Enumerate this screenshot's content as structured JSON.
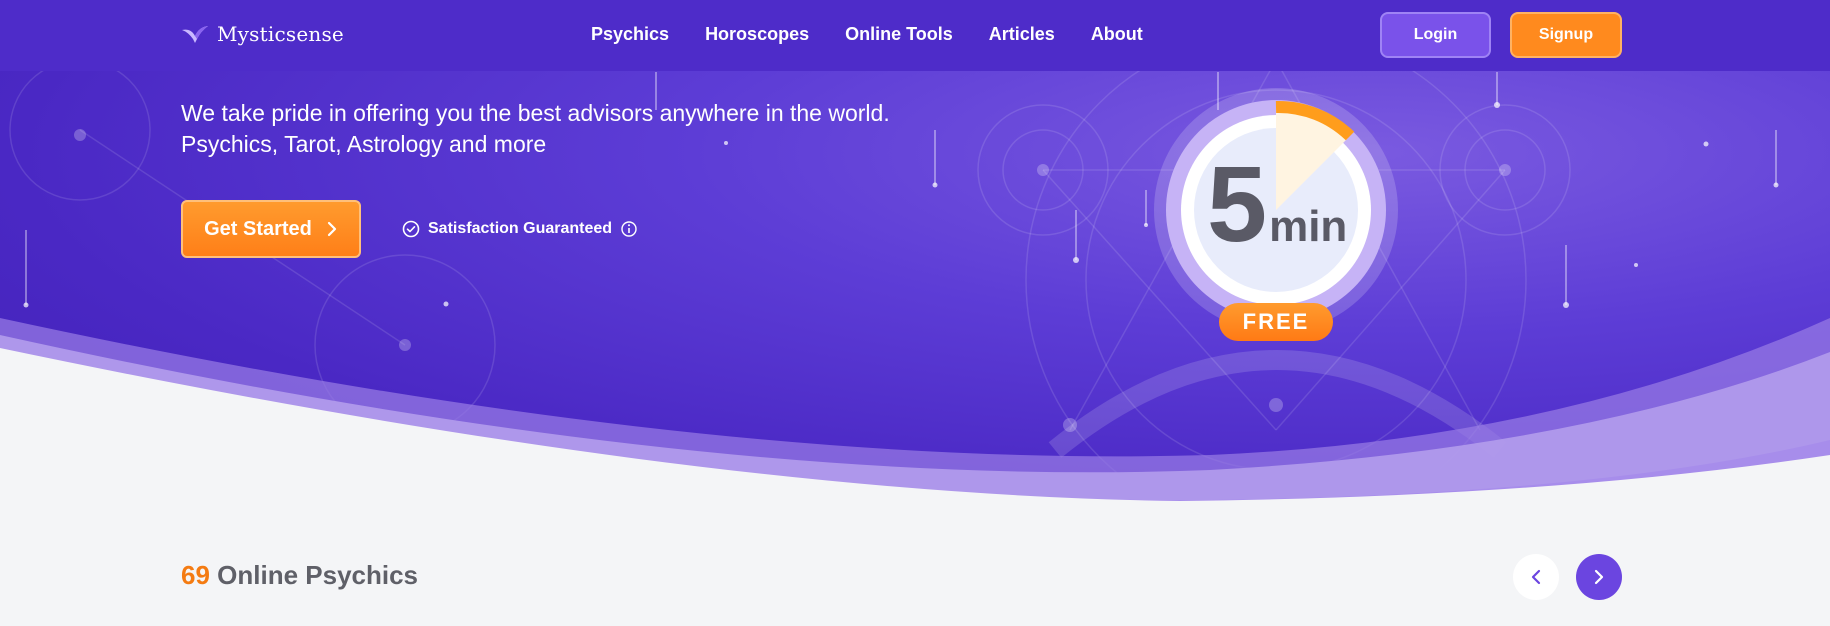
{
  "brand": {
    "name": "Mysticsense",
    "logo_icon": "bird-logo-icon"
  },
  "nav": {
    "items": [
      {
        "label": "Psychics"
      },
      {
        "label": "Horoscopes"
      },
      {
        "label": "Online Tools"
      },
      {
        "label": "Articles"
      },
      {
        "label": "About"
      }
    ]
  },
  "auth": {
    "login_label": "Login",
    "signup_label": "Signup"
  },
  "hero": {
    "line1": "We take pride in offering you the best advisors anywhere in the world.",
    "line2": "Psychics, Tarot, Astrology and more",
    "cta_label": "Get Started",
    "satisfaction_label": "Satisfaction Guaranteed"
  },
  "timer": {
    "number": "5",
    "unit": "min",
    "badge": "FREE"
  },
  "section": {
    "count": "69",
    "title": "Online Psychics"
  },
  "colors": {
    "primary_purple": "#4e2cc9",
    "accent_orange": "#ff8a1e",
    "text_gray": "#5f6068",
    "count_orange": "#f47b12"
  },
  "icons": {
    "cta": "chevron-right-icon",
    "satisfaction": "check-circle-icon",
    "info": "info-icon",
    "prev": "chevron-left-icon",
    "next": "chevron-right-icon"
  }
}
